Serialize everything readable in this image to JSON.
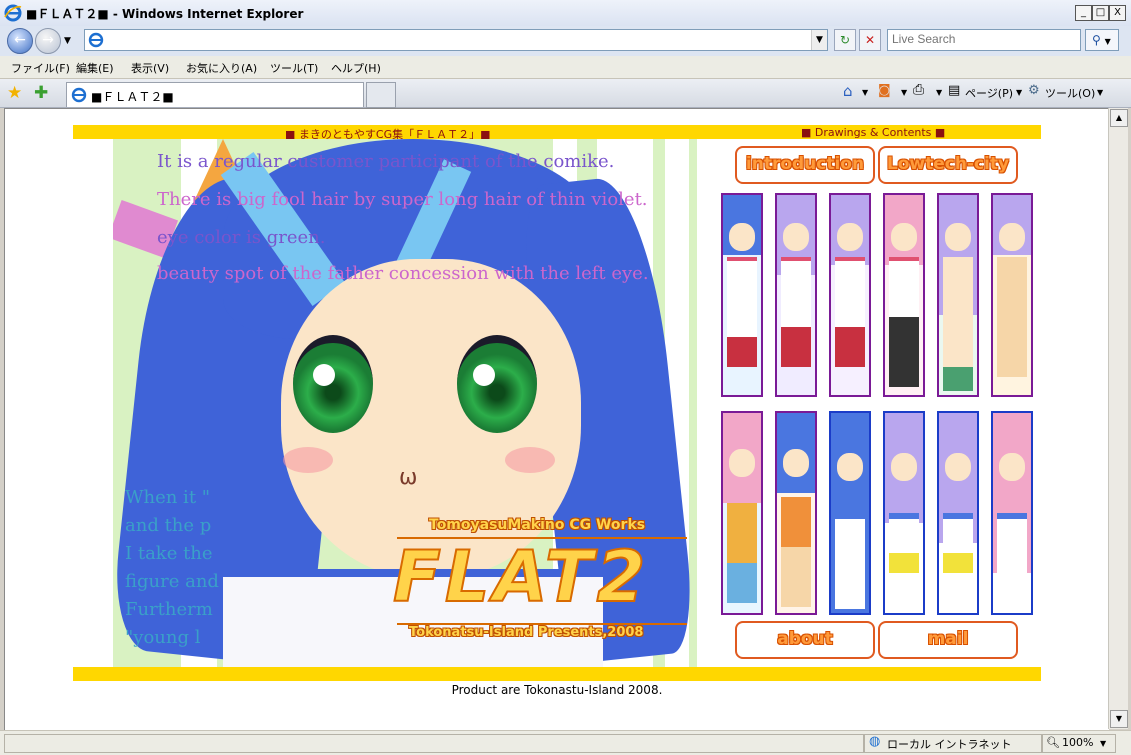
{
  "window": {
    "title": "■ＦＬＡＴ２■ - Windows Internet Explorer",
    "min": "_",
    "max": "□",
    "close": "X"
  },
  "toolbar": {
    "address_value": "",
    "search_placeholder": "Live Search",
    "refresh_glyph": "↻",
    "stop_glyph": "✕",
    "search_glyph": "⚲"
  },
  "menu": [
    "ファイル(F)",
    "編集(E)",
    "表示(V)",
    "お気に入り(A)",
    "ツール(T)",
    "ヘルプ(H)"
  ],
  "tab": {
    "title": "■ＦＬＡＴ２■"
  },
  "commands": {
    "page": "ページ(P)",
    "tools": "ツール(O)"
  },
  "status": {
    "zone": "ローカル イントラネット",
    "zoom": "100%"
  },
  "page": {
    "top_left_label": "■ まきのともやすCG集「ＦＬＡＴ２」■",
    "top_right_label": "■ Drawings & Contents ■",
    "art_text": [
      "It is a regular customer participant of the comike.",
      "There is big fool hair by super long hair of thin violet.",
      "eye color is green.",
      "beauty spot of the father concession with the left eye."
    ],
    "art_text_lower": [
      "When it \"",
      " and the p",
      " I take the",
      "figure and",
      "Furtherm",
      " \"young l"
    ],
    "logo": {
      "top": "TomoyasuMakino CG Works",
      "main": "FLAT2",
      "bottom": "Tokonatsu-Island Presents,2008"
    },
    "nav": {
      "introduction": "introduction",
      "lowtech": "Lowtech-city",
      "about": "about",
      "mail": "mail"
    },
    "footer": "Product are Tokonastu-Island 2008."
  },
  "colors": {
    "band": "#ffd700",
    "art_green": "#d9f2c2",
    "hair_blue": "#3f63d8",
    "hair_violet": "#b9a6ee",
    "hair_pink": "#f2a7c8",
    "pill_border": "#e05a20"
  }
}
